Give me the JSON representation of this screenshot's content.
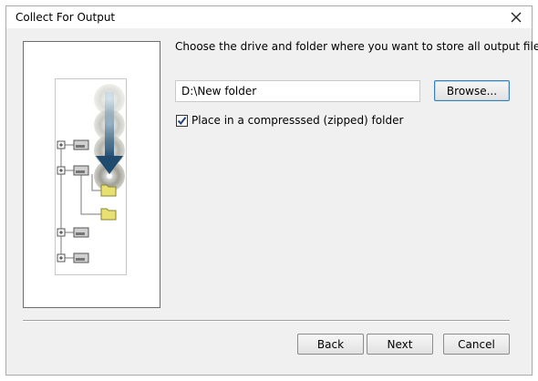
{
  "window": {
    "title": "Collect For Output"
  },
  "main": {
    "prompt": "Choose the drive and folder where you want to store all output files.",
    "path_value": "D:\\New folder",
    "browse_label": "Browse...",
    "zip_checked": true,
    "zip_label": "Place in a compresssed (zipped) folder"
  },
  "footer": {
    "back_label": "Back",
    "next_label": "Next",
    "cancel_label": "Cancel"
  },
  "icons": {
    "close": "close-icon",
    "illustration": "collect-output-illustration",
    "checkmark": "checkmark-icon"
  },
  "colors": {
    "window_bg": "#f0f0f0",
    "folder_yellow": "#e8e070",
    "arrow_blue": "#2c5a80",
    "browse_focus_border": "#3c7fb1"
  }
}
